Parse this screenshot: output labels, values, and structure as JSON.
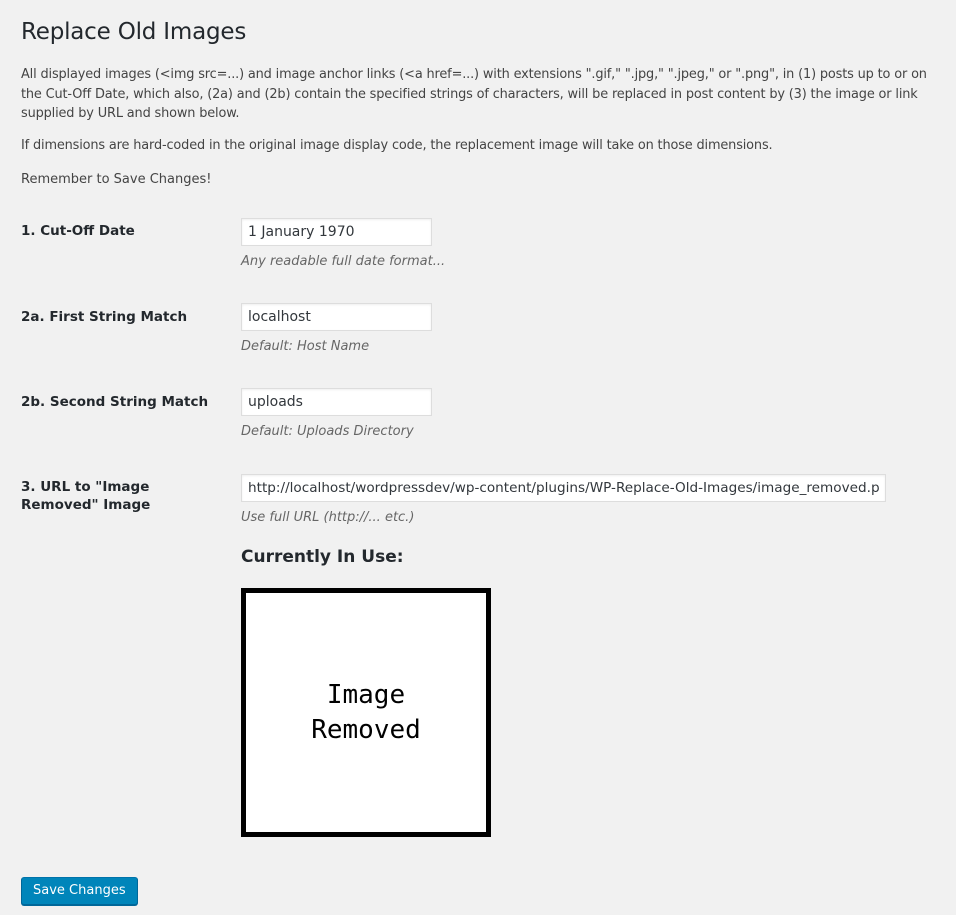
{
  "page": {
    "title": "Replace Old Images",
    "description": "All displayed images (<img src=...) and image anchor links (<a href=...) with extensions \".gif,\" \".jpg,\" \".jpeg,\" or \".png\", in (1) posts up to or on the Cut-Off Date, which also, (2a) and (2b) contain the specified strings of characters, will be replaced in post content by (3) the image or link supplied by URL and shown below.",
    "dimensions_note": "If dimensions are hard-coded in the original image display code, the replacement image will take on those dimensions.",
    "reminder": "Remember to Save Changes!"
  },
  "form": {
    "cutoff": {
      "label": "1. Cut-Off Date",
      "value": "1 January 1970",
      "hint": "Any readable full date format..."
    },
    "first_string": {
      "label": "2a. First String Match",
      "value": "localhost",
      "hint": "Default: Host Name"
    },
    "second_string": {
      "label": "2b. Second String Match",
      "value": "uploads",
      "hint": "Default: Uploads Directory"
    },
    "image_url": {
      "label": "3. URL to \"Image Removed\" Image",
      "value": "http://localhost/wordpressdev/wp-content/plugins/WP-Replace-Old-Images/image_removed.png",
      "hint": "Use full URL (http://... etc.)"
    }
  },
  "preview": {
    "heading": "Currently In Use:",
    "line1": "Image",
    "line2": "Removed"
  },
  "actions": {
    "save_label": "Save Changes"
  },
  "colors": {
    "background": "#f1f1f1",
    "primary_button": "#0085ba"
  }
}
